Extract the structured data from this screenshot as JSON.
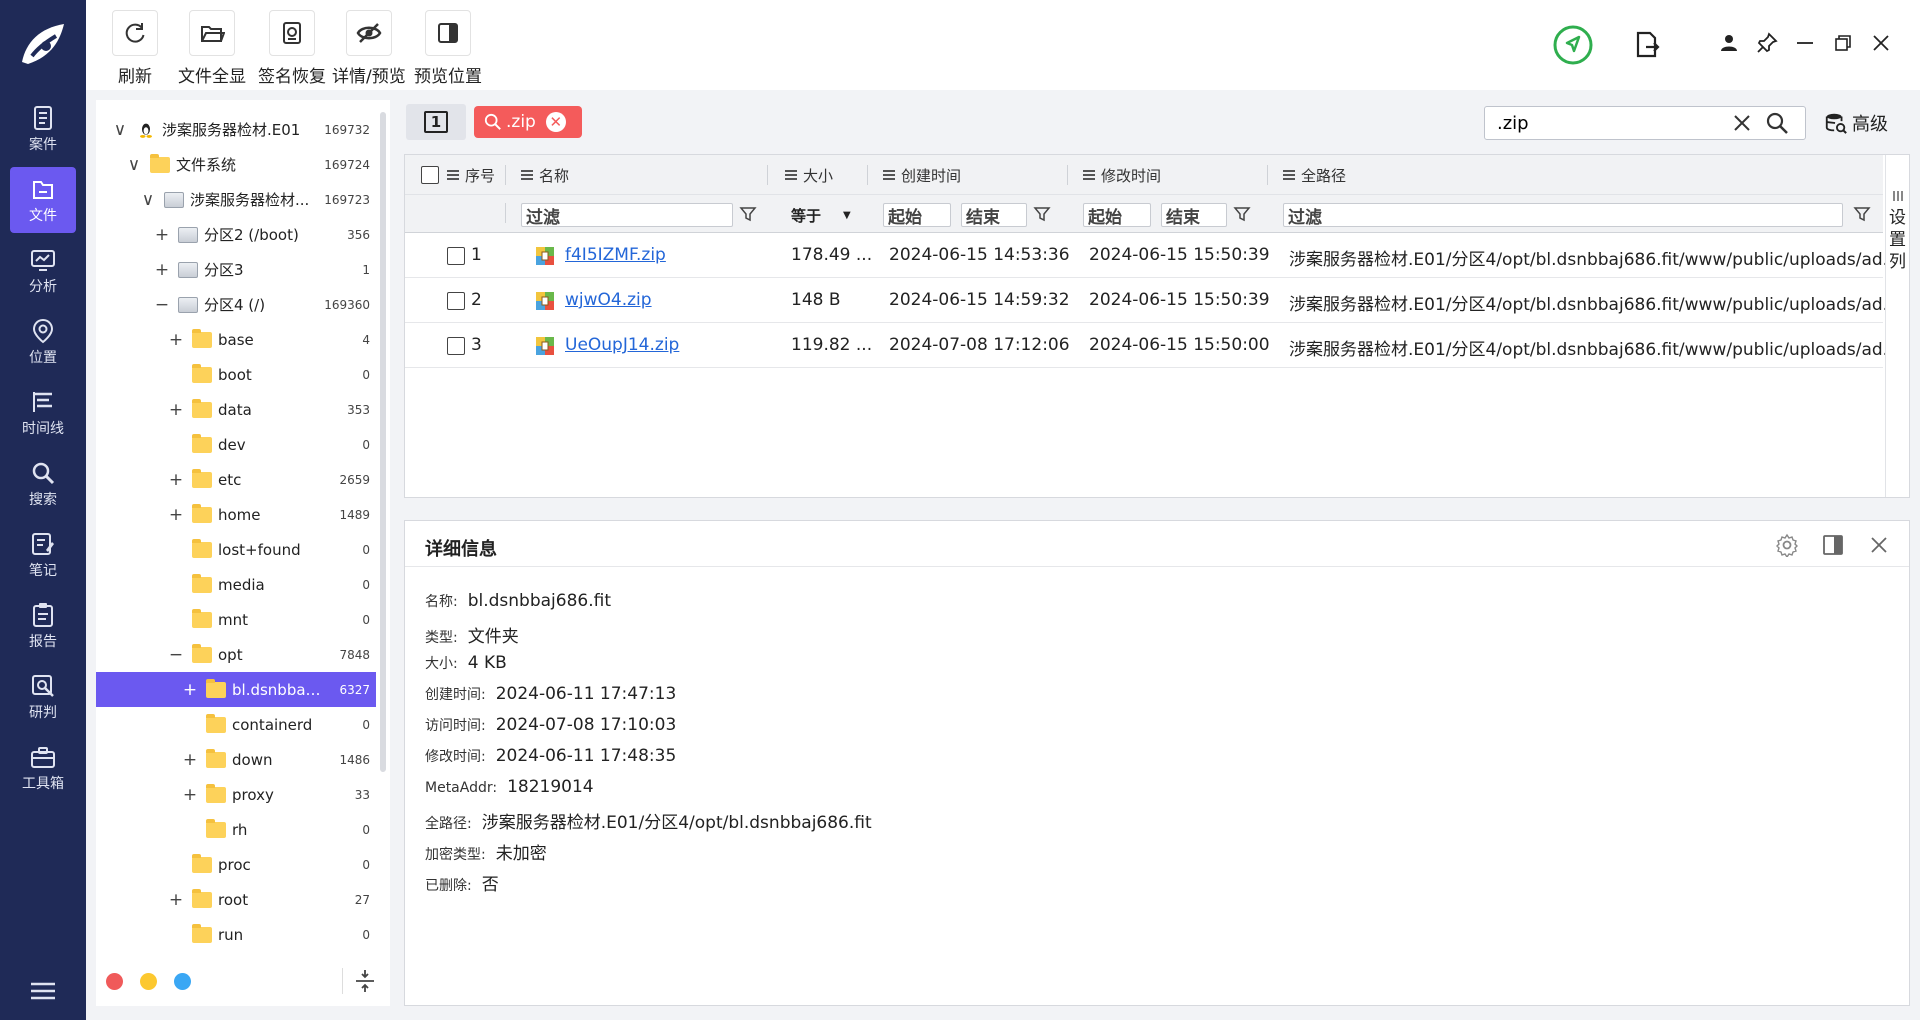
{
  "nav": {
    "items": [
      {
        "label": "案件"
      },
      {
        "label": "文件"
      },
      {
        "label": "分析"
      },
      {
        "label": "位置"
      },
      {
        "label": "时间线"
      },
      {
        "label": "搜索"
      },
      {
        "label": "笔记"
      },
      {
        "label": "报告"
      },
      {
        "label": "研判"
      },
      {
        "label": "工具箱"
      }
    ],
    "active_index": 1
  },
  "toolbar": {
    "buttons": [
      {
        "label": "刷新",
        "icon": "refresh-icon"
      },
      {
        "label": "文件全显",
        "icon": "folder-open-icon"
      },
      {
        "label": "签名恢复",
        "icon": "signature-recover-icon"
      },
      {
        "label": "详情/预览",
        "icon": "eye-off-icon"
      },
      {
        "label": "预览位置",
        "icon": "preview-position-icon"
      }
    ]
  },
  "tree": {
    "nodes": [
      {
        "name": "涉案服务器检材.E01",
        "count": "169732",
        "expander": "∨",
        "icon": "linux-icon"
      },
      {
        "name": "文件系统",
        "count": "169724",
        "expander": "∨",
        "icon": "folder-icon"
      },
      {
        "name": "涉案服务器检材...",
        "count": "169723",
        "expander": "∨",
        "icon": "disk-icon"
      },
      {
        "name": "分区2 (/boot)",
        "count": "356",
        "expander": "+",
        "icon": "disk-icon"
      },
      {
        "name": "分区3",
        "count": "1",
        "expander": "+",
        "icon": "disk-icon"
      },
      {
        "name": "分区4 (/)",
        "count": "169360",
        "expander": "−",
        "icon": "disk-icon"
      },
      {
        "name": "base",
        "count": "4",
        "expander": "+",
        "icon": "folder-icon"
      },
      {
        "name": "boot",
        "count": "0",
        "expander": "",
        "icon": "folder-icon"
      },
      {
        "name": "data",
        "count": "353",
        "expander": "+",
        "icon": "folder-icon"
      },
      {
        "name": "dev",
        "count": "0",
        "expander": "",
        "icon": "folder-icon"
      },
      {
        "name": "etc",
        "count": "2659",
        "expander": "+",
        "icon": "folder-icon"
      },
      {
        "name": "home",
        "count": "1489",
        "expander": "+",
        "icon": "folder-icon"
      },
      {
        "name": "lost+found",
        "count": "0",
        "expander": "",
        "icon": "folder-icon"
      },
      {
        "name": "media",
        "count": "0",
        "expander": "",
        "icon": "folder-icon"
      },
      {
        "name": "mnt",
        "count": "0",
        "expander": "",
        "icon": "folder-icon"
      },
      {
        "name": "opt",
        "count": "7848",
        "expander": "−",
        "icon": "folder-icon"
      },
      {
        "name": "bl.dsnbbaj68...",
        "count": "6327",
        "expander": "+",
        "icon": "folder-icon",
        "selected": true
      },
      {
        "name": "containerd",
        "count": "0",
        "expander": "",
        "icon": "folder-icon"
      },
      {
        "name": "down",
        "count": "1486",
        "expander": "+",
        "icon": "folder-icon"
      },
      {
        "name": "proxy",
        "count": "33",
        "expander": "+",
        "icon": "folder-icon"
      },
      {
        "name": "rh",
        "count": "0",
        "expander": "",
        "icon": "folder-icon"
      },
      {
        "name": "proc",
        "count": "0",
        "expander": "",
        "icon": "folder-icon"
      },
      {
        "name": "root",
        "count": "27",
        "expander": "+",
        "icon": "folder-icon"
      },
      {
        "name": "run",
        "count": "0",
        "expander": "",
        "icon": "folder-icon"
      }
    ],
    "dots": [
      "#f05a5a",
      "#fcc82f",
      "#3aa7f4"
    ]
  },
  "search": {
    "tab_label": "1",
    "chip_label": ".zip",
    "input_value": ".zip",
    "advanced_label": "高级"
  },
  "list": {
    "columns": {
      "index": "序号",
      "name": "名称",
      "size": "大小",
      "created": "创建时间",
      "modified": "修改时间",
      "path": "全路径"
    },
    "filter": {
      "name_placeholder": "过滤",
      "size_op": "等于",
      "created_start": "起始",
      "created_end": "结束",
      "modified_start": "起始",
      "modified_end": "结束",
      "path_placeholder": "过滤"
    },
    "rows": [
      {
        "index": "1",
        "name": "f4I5IZMF.zip",
        "size": "178.49 ...",
        "created": "2024-06-15 14:53:36",
        "modified": "2024-06-15 15:50:39",
        "path": "涉案服务器检材.E01/分区4/opt/bl.dsnbbaj686.fit/www/public/uploads/ad..."
      },
      {
        "index": "2",
        "name": "wjwO4.zip",
        "size": "148 B",
        "created": "2024-06-15 14:59:32",
        "modified": "2024-06-15 15:50:39",
        "path": "涉案服务器检材.E01/分区4/opt/bl.dsnbbaj686.fit/www/public/uploads/ad..."
      },
      {
        "index": "3",
        "name": "UeOupJ14.zip",
        "size": "119.82 ...",
        "created": "2024-07-08 17:12:06",
        "modified": "2024-06-15 15:50:00",
        "path": "涉案服务器检材.E01/分区4/opt/bl.dsnbbaj686.fit/www/public/uploads/ad..."
      }
    ],
    "column_settings_label": "设置列"
  },
  "detail": {
    "title": "详细信息",
    "fields": [
      {
        "key": "名称:",
        "value": "bl.dsnbbaj686.fit"
      },
      {
        "key": "类型:",
        "value": "文件夹"
      },
      {
        "key": "大小:",
        "value": "4 KB"
      },
      {
        "key": "创建时间:",
        "value": "2024-06-11 17:47:13"
      },
      {
        "key": "访问时间:",
        "value": "2024-07-08 17:10:03"
      },
      {
        "key": "修改时间:",
        "value": "2024-06-11 17:48:35"
      },
      {
        "key": "MetaAddr:",
        "value": "18219014"
      },
      {
        "key": "全路径:",
        "value": "涉案服务器检材.E01/分区4/opt/bl.dsnbbaj686.fit"
      },
      {
        "key": "加密类型:",
        "value": "未加密"
      },
      {
        "key": "已删除:",
        "value": "否"
      }
    ]
  },
  "colors": {
    "nav_bg": "#1f2a57",
    "accent": "#6b59f0",
    "chip": "#f45b5b",
    "link": "#2366d8",
    "shield": "#2fae4e"
  }
}
